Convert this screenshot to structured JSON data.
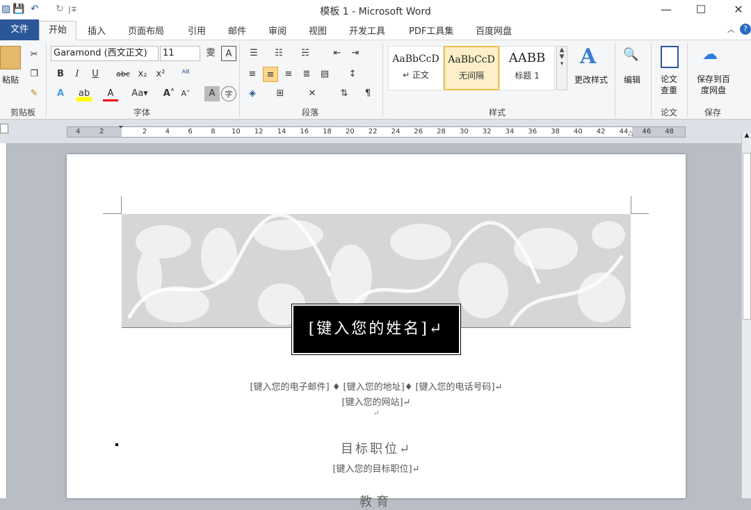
{
  "window": {
    "title": "模板 1 - Microsoft Word",
    "minimize": "—",
    "maximize": "☐",
    "close": "✕"
  },
  "quick_access": {
    "save": "💾",
    "undo": "↶",
    "redo": "↻",
    "dropdown": "|∓"
  },
  "tabs": [
    "文件",
    "开始",
    "插入",
    "页面布局",
    "引用",
    "邮件",
    "审阅",
    "视图",
    "开发工具",
    "PDF工具集",
    "百度网盘"
  ],
  "ribbon": {
    "clipboard": {
      "paste": "粘贴",
      "label": "剪贴板"
    },
    "font": {
      "name": "Garamond (西文正文)",
      "size": "11",
      "label": "字体"
    },
    "paragraph": {
      "label": "段落"
    },
    "styles": {
      "label": "样式",
      "items": [
        {
          "sample": "AaBbCcD",
          "name": "↵ 正文"
        },
        {
          "sample": "AaBbCcD",
          "name": "无间隔"
        },
        {
          "sample": "AABB",
          "name": "标题 1"
        }
      ],
      "change": "更改样式"
    },
    "edit": {
      "label": "编辑"
    },
    "paper": {
      "check": "论文\n查重",
      "label": "论文"
    },
    "save": {
      "btn": "保存到百\n度网盘",
      "label": "保存"
    }
  },
  "ruler": {
    "left_nums": [
      "4",
      "2"
    ],
    "nums": [
      "2",
      "4",
      "6",
      "8",
      "10",
      "12",
      "14",
      "16",
      "18",
      "20",
      "22",
      "24",
      "26",
      "28",
      "30",
      "32",
      "34",
      "36",
      "38",
      "40",
      "42",
      "44",
      "46",
      "48"
    ]
  },
  "document": {
    "name_placeholder": "[键入您的姓名]↵",
    "contact_line": "[键入您的电子邮件] ♦ [键入您的地址]♦ [键入您的电话号码]↵",
    "website": "[键入您的网站]↵",
    "empty_para": "↵",
    "section_title": "目标职位↵",
    "section_body": "[键入您的目标职位]↵",
    "next_heading": "教育"
  }
}
